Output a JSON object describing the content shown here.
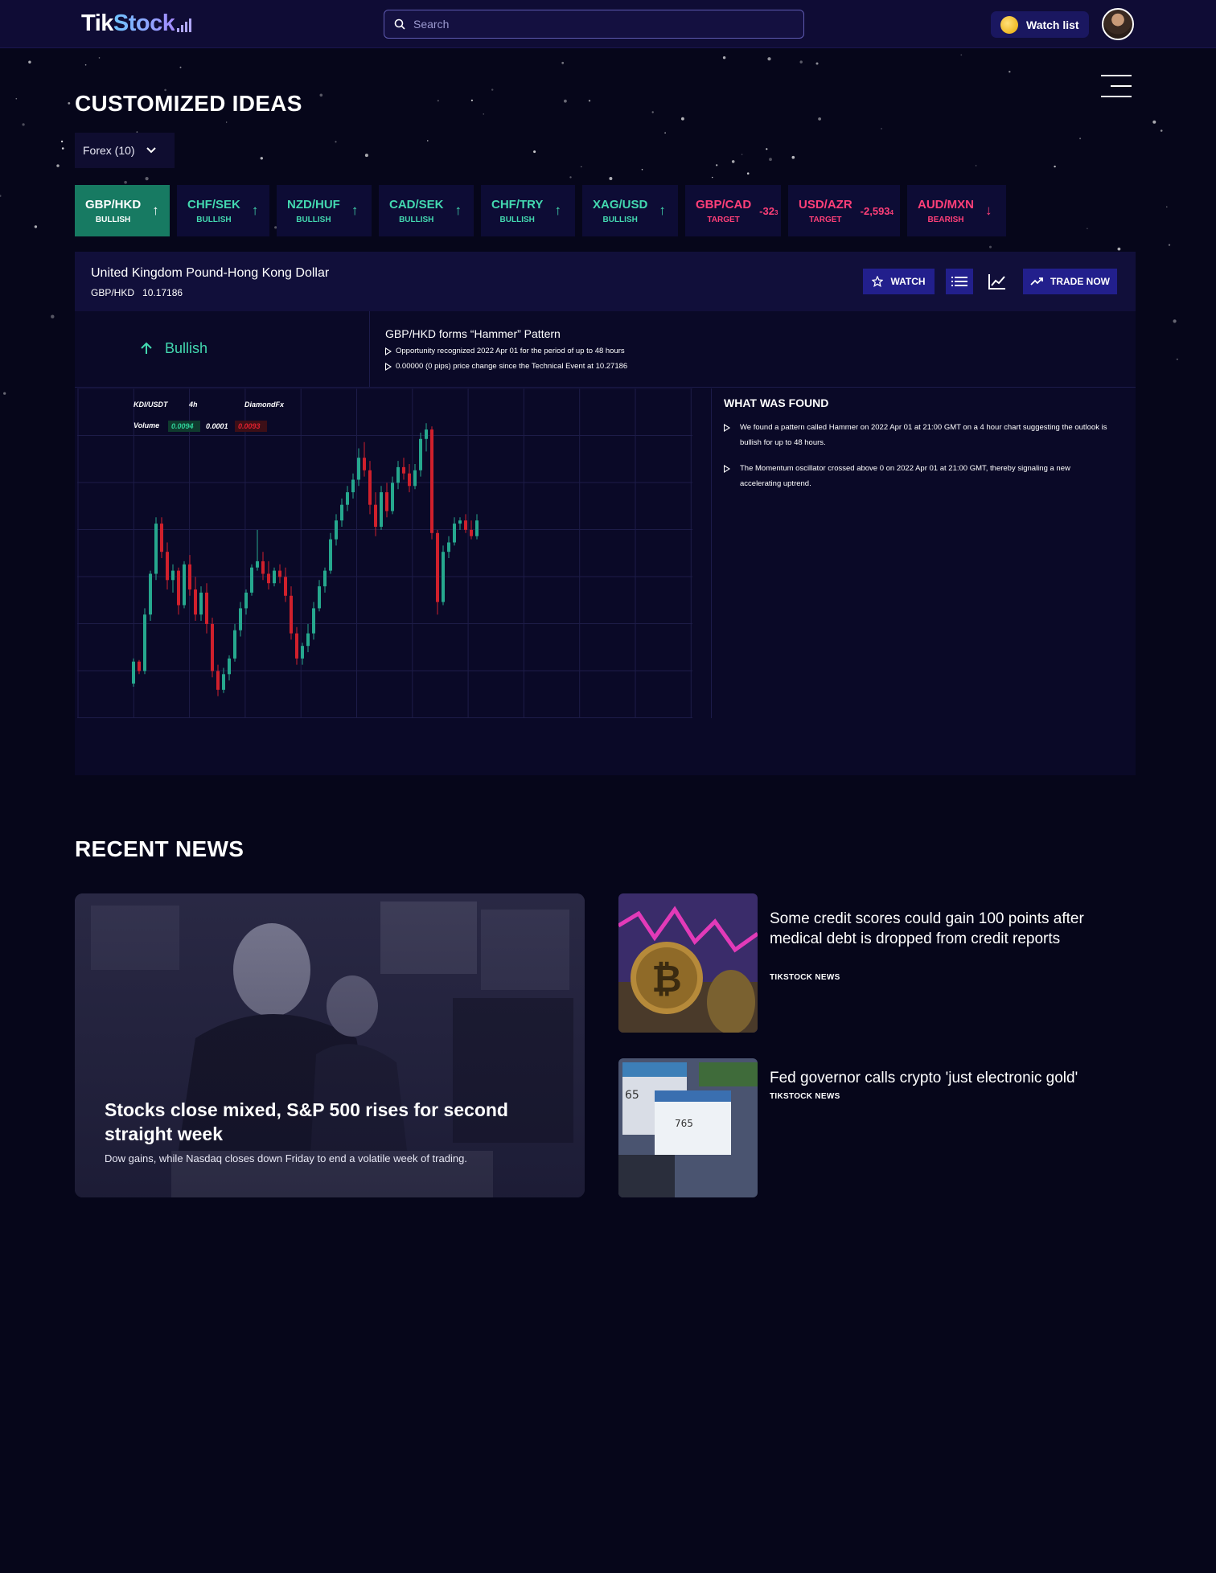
{
  "header": {
    "logo_tik": "Tik",
    "logo_stock": "Stock",
    "search_placeholder": "Search",
    "watchlist_label": "Watch list"
  },
  "ideas": {
    "title": "CUSTOMIZED IDEAS",
    "filter_label": "Forex (10)",
    "pairs": [
      {
        "name": "GBP/HKD",
        "sub": "BULLISH",
        "arrow": "↑"
      },
      {
        "name": "CHF/SEK",
        "sub": "BULLISH",
        "arrow": "↑"
      },
      {
        "name": "NZD/HUF",
        "sub": "BULLISH",
        "arrow": "↑"
      },
      {
        "name": "CAD/SEK",
        "sub": "BULLISH",
        "arrow": "↑"
      },
      {
        "name": "CHF/TRY",
        "sub": "BULLISH",
        "arrow": "↑"
      },
      {
        "name": "XAG/USD",
        "sub": "BULLISH",
        "arrow": "↑"
      },
      {
        "name": "GBP/CAD",
        "sub": "TARGET",
        "value": "-32",
        "value_sub": "3"
      },
      {
        "name": "USD/AZR",
        "sub": "TARGET",
        "value": "-2,593",
        "value_sub": "4"
      },
      {
        "name": "AUD/MXN",
        "sub": "BEARISH",
        "arrow": "↓"
      }
    ]
  },
  "detail": {
    "title": "United Kingdom Pound-Hong Kong Dollar",
    "symbol": "GBP/HKD",
    "price": "10.17186",
    "watch_label": "WATCH",
    "trade_label": "TRADE NOW",
    "sentiment": "Bullish",
    "pattern_title": "GBP/HKD forms “Hammer” Pattern",
    "pattern_lines": [
      "Opportunity recognized 2022 Apr 01 for the period of up to 48 hours",
      "0.00000 (0 pips) price change since the Technical Event at 10.27186"
    ],
    "found_title": "WHAT WAS FOUND",
    "found_items": [
      "We found a pattern called Hammer on 2022 Apr 01 at 21:00 GMT on a 4 hour chart suggesting the outlook is bullish for up to 48 hours.",
      "The Momentum oscillator crossed above 0 on 2022 Apr 01 at 21:00 GMT, thereby signaling a new accelerating uptrend."
    ]
  },
  "chart_data": {
    "type": "candlestick",
    "symbol": "KDI/USDT",
    "interval": "4h",
    "source": "DiamondFx",
    "volume_label": "Volume",
    "volume_values": [
      "0.0094",
      "0.0001",
      "0.0093"
    ],
    "colors": {
      "up": "#26a88e",
      "down": "#d0202c"
    },
    "candles": [
      [
        10.0,
        10.8,
        9.9,
        10.7
      ],
      [
        10.7,
        10.75,
        10.3,
        10.4
      ],
      [
        10.4,
        12.4,
        10.3,
        12.2
      ],
      [
        12.2,
        13.6,
        12.0,
        13.5
      ],
      [
        13.5,
        15.3,
        13.3,
        15.1
      ],
      [
        15.1,
        15.3,
        14.0,
        14.2
      ],
      [
        14.2,
        14.5,
        13.0,
        13.3
      ],
      [
        13.3,
        13.8,
        12.9,
        13.6
      ],
      [
        13.6,
        13.7,
        12.2,
        12.5
      ],
      [
        12.5,
        13.9,
        12.4,
        13.8
      ],
      [
        13.8,
        14.1,
        12.8,
        13.0
      ],
      [
        13.0,
        13.4,
        12.0,
        12.2
      ],
      [
        12.2,
        13.1,
        12.0,
        12.9
      ],
      [
        12.9,
        13.2,
        11.6,
        11.9
      ],
      [
        11.9,
        12.1,
        10.2,
        10.4
      ],
      [
        10.4,
        10.6,
        9.6,
        9.8
      ],
      [
        9.8,
        10.5,
        9.7,
        10.3
      ],
      [
        10.3,
        10.9,
        10.1,
        10.8
      ],
      [
        10.8,
        11.9,
        10.7,
        11.7
      ],
      [
        11.7,
        12.6,
        11.5,
        12.4
      ],
      [
        12.4,
        13.0,
        12.2,
        12.9
      ],
      [
        12.9,
        13.8,
        12.8,
        13.7
      ],
      [
        13.7,
        14.9,
        13.6,
        13.9
      ],
      [
        13.9,
        14.2,
        13.3,
        13.5
      ],
      [
        13.5,
        13.9,
        13.0,
        13.2
      ],
      [
        13.2,
        13.7,
        13.1,
        13.6
      ],
      [
        13.6,
        13.8,
        13.2,
        13.4
      ],
      [
        13.4,
        13.7,
        12.6,
        12.8
      ],
      [
        12.8,
        13.1,
        11.4,
        11.6
      ],
      [
        11.6,
        11.8,
        10.6,
        10.8
      ],
      [
        10.8,
        11.3,
        10.6,
        11.2
      ],
      [
        11.2,
        11.9,
        11.0,
        11.6
      ],
      [
        11.6,
        12.6,
        11.4,
        12.4
      ],
      [
        12.4,
        13.3,
        12.3,
        13.1
      ],
      [
        13.1,
        13.7,
        12.9,
        13.6
      ],
      [
        13.6,
        14.8,
        13.5,
        14.6
      ],
      [
        14.6,
        15.4,
        14.4,
        15.2
      ],
      [
        15.2,
        15.9,
        15.0,
        15.7
      ],
      [
        15.7,
        16.3,
        15.5,
        16.1
      ],
      [
        16.1,
        16.7,
        15.9,
        16.5
      ],
      [
        16.5,
        17.5,
        16.3,
        17.2
      ],
      [
        17.2,
        17.7,
        16.6,
        16.8
      ],
      [
        16.8,
        17.1,
        15.4,
        15.7
      ],
      [
        15.7,
        16.1,
        14.7,
        15.0
      ],
      [
        15.0,
        16.3,
        14.9,
        16.1
      ],
      [
        16.1,
        16.4,
        15.3,
        15.5
      ],
      [
        15.5,
        16.6,
        15.4,
        16.4
      ],
      [
        16.4,
        17.1,
        16.2,
        16.9
      ],
      [
        16.9,
        17.2,
        16.5,
        16.7
      ],
      [
        16.7,
        17.0,
        16.1,
        16.3
      ],
      [
        16.3,
        17.0,
        16.2,
        16.8
      ],
      [
        16.8,
        18.0,
        16.6,
        17.8
      ],
      [
        17.8,
        18.3,
        17.4,
        18.1
      ],
      [
        18.1,
        18.2,
        14.6,
        14.8
      ],
      [
        14.8,
        14.9,
        12.2,
        12.6
      ],
      [
        12.6,
        14.4,
        12.5,
        14.2
      ],
      [
        14.2,
        14.7,
        14.0,
        14.5
      ],
      [
        14.5,
        15.3,
        14.4,
        15.1
      ],
      [
        15.1,
        15.3,
        14.9,
        15.2
      ],
      [
        15.2,
        15.4,
        14.8,
        14.9
      ],
      [
        14.9,
        15.2,
        14.6,
        14.7
      ],
      [
        14.7,
        15.4,
        14.6,
        15.2
      ]
    ],
    "ylim": [
      9.0,
      19.0
    ]
  },
  "news": {
    "title": "RECENT NEWS",
    "featured": {
      "headline": "Stocks close mixed, S&P 500 rises for second straight week",
      "desc": "Dow gains, while Nasdaq closes down Friday to end a volatile week of trading."
    },
    "items": [
      {
        "headline": "Some credit scores could gain 100 points after medical debt is dropped from credit reports",
        "source": "TIKSTOCK NEWS"
      },
      {
        "headline": "Fed governor calls crypto 'just electronic gold'",
        "source": "TIKSTOCK NEWS"
      }
    ]
  }
}
